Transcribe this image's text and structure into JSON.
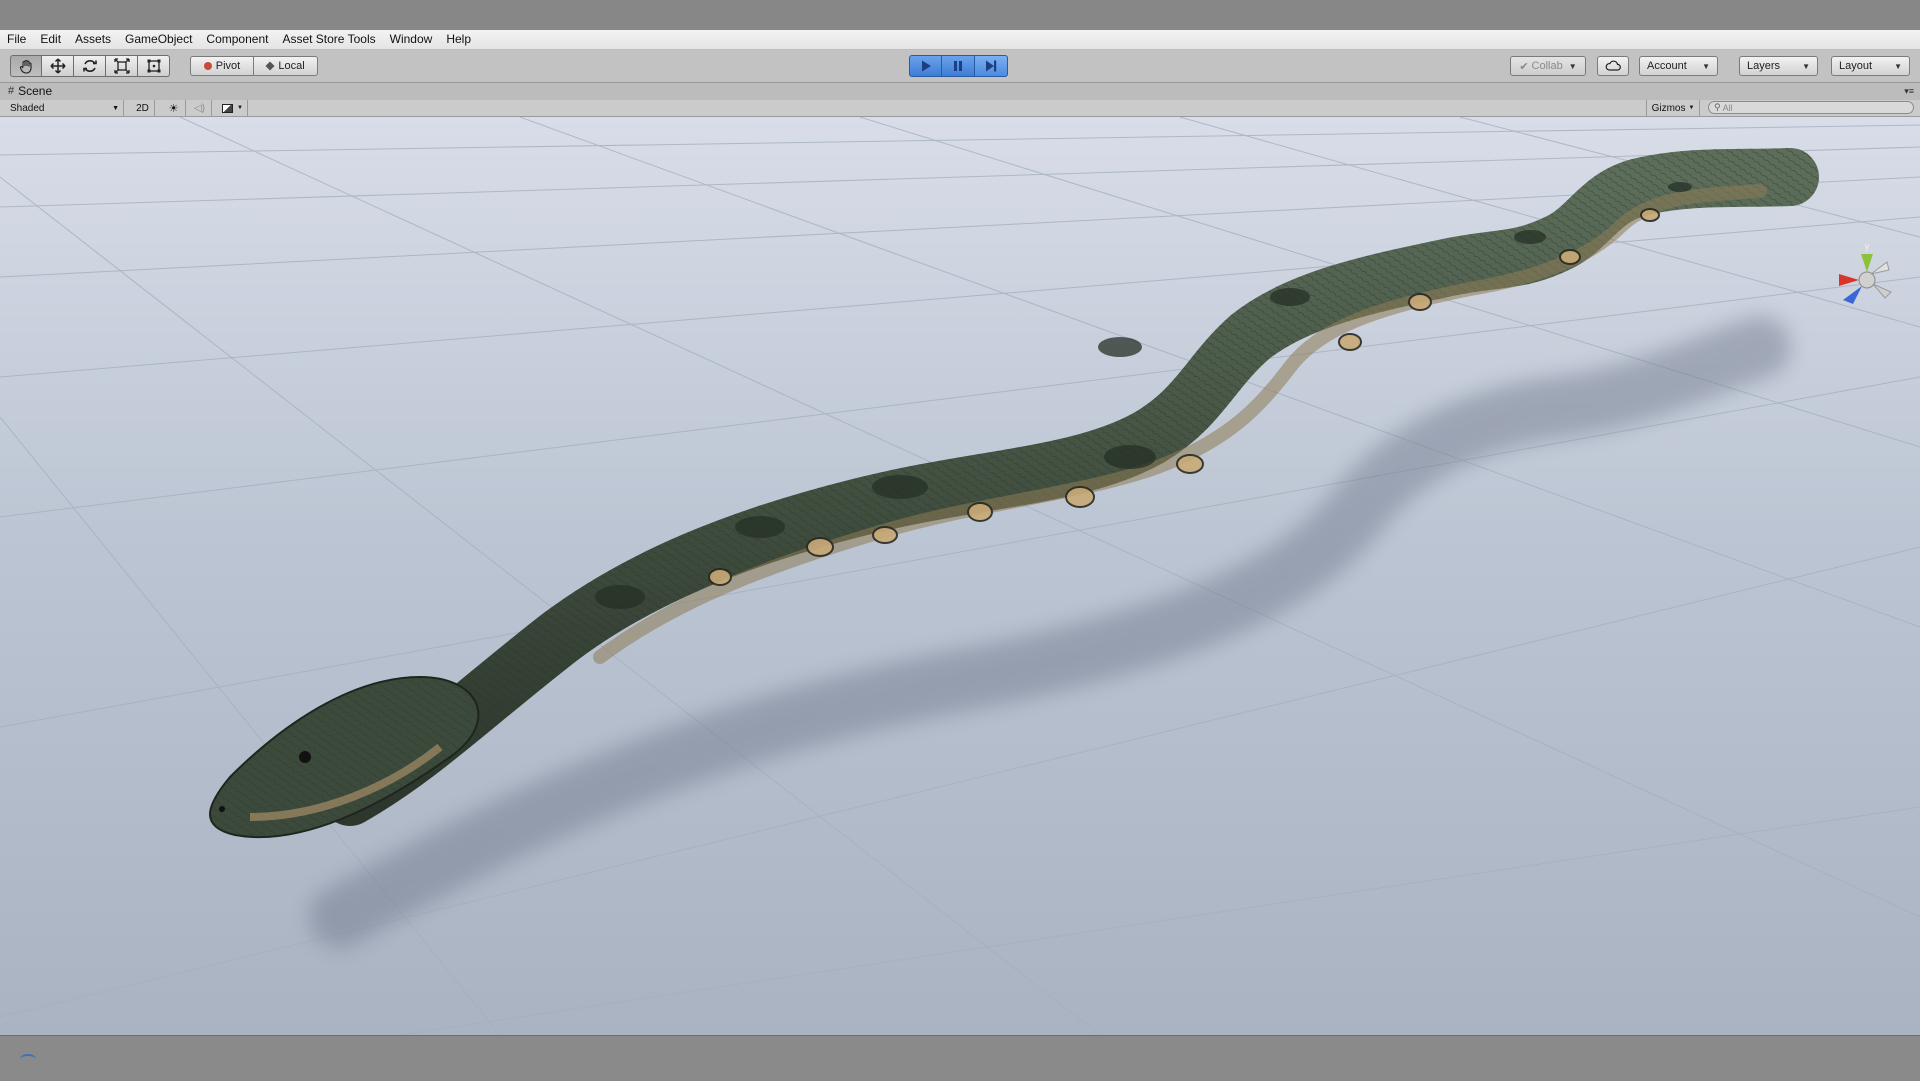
{
  "menu": [
    "File",
    "Edit",
    "Assets",
    "GameObject",
    "Component",
    "Asset Store Tools",
    "Window",
    "Help"
  ],
  "toolbar": {
    "pivot_label": "Pivot",
    "local_label": "Local",
    "collab_label": "Collab",
    "account_label": "Account",
    "layers_label": "Layers",
    "layout_label": "Layout"
  },
  "scene": {
    "tab_label": "Scene",
    "shading_mode": "Shaded",
    "mode_2d_label": "2D",
    "gizmos_label": "Gizmos",
    "search_placeholder": "All",
    "gizmo_axis_label": "y"
  },
  "colors": {
    "menu_bg": "#eaeaea",
    "toolbar_bg": "#c2c2c2",
    "play_active": "#3e7dd6",
    "ground": "#b8c2d0",
    "snake_body": "#4a5a48",
    "snake_belly": "#b59a6e"
  }
}
